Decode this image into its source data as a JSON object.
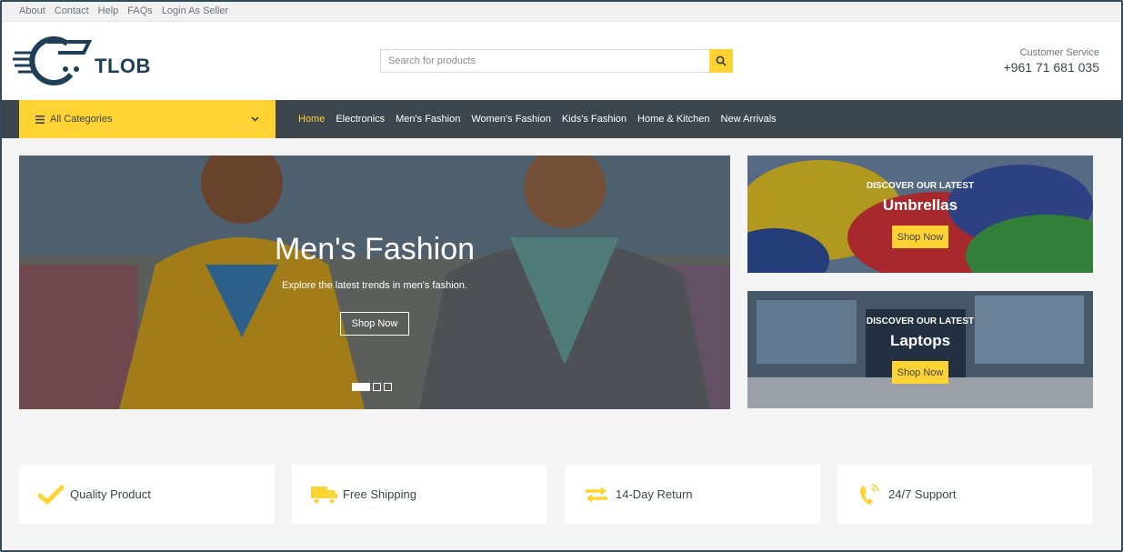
{
  "topbar": {
    "links": [
      "About",
      "Contact",
      "Help",
      "FAQs",
      "Login As Seller"
    ]
  },
  "header": {
    "logo_text": "TLOB",
    "search_placeholder": "Search for products",
    "customer_service_label": "Customer Service",
    "phone": "+961 71 681 035"
  },
  "nav": {
    "categories_label": "All Categories",
    "items": [
      "Home",
      "Electronics",
      "Men's Fashion",
      "Women's Fashion",
      "Kids's Fashion",
      "Home & Kitchen",
      "New Arrivals"
    ],
    "active_index": 0
  },
  "hero": {
    "title": "Men's Fashion",
    "subtitle": "Explore the latest trends in men's fashion.",
    "button": "Shop Now",
    "slide_count": 3,
    "active_slide": 0
  },
  "promos": [
    {
      "kicker": "DISCOVER OUR LATEST",
      "title": "Umbrellas",
      "button": "Shop Now"
    },
    {
      "kicker": "DISCOVER OUR LATEST",
      "title": "Laptops",
      "button": "Shop Now"
    }
  ],
  "features": [
    {
      "icon": "check-icon",
      "label": "Quality Product"
    },
    {
      "icon": "truck-icon",
      "label": "Free Shipping"
    },
    {
      "icon": "exchange-icon",
      "label": "14-Day Return"
    },
    {
      "icon": "phone-volume-icon",
      "label": "24/7 Support"
    }
  ],
  "colors": {
    "accent": "#ffd333",
    "dark": "#3d464d",
    "background": "#f5f5f5"
  }
}
